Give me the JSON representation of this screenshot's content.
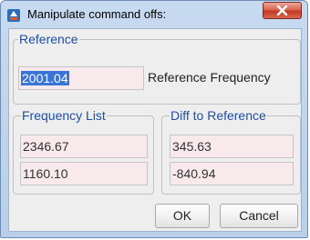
{
  "window": {
    "title": "Manipulate command offs:",
    "close_label": "x"
  },
  "reference": {
    "legend": "Reference",
    "value": "2001.04",
    "label": "Reference Frequency"
  },
  "frequency_list": {
    "legend": "Frequency List",
    "values": [
      "2346.67",
      "1160.10"
    ]
  },
  "diff": {
    "legend": "Diff to Reference",
    "values": [
      "345.63",
      "-840.94"
    ]
  },
  "buttons": {
    "ok": "OK",
    "cancel": "Cancel"
  },
  "colors": {
    "legend": "#1f4fa0",
    "field_bg": "#f7e9ec",
    "selection": "#3875d7",
    "close": "#c23a24"
  }
}
